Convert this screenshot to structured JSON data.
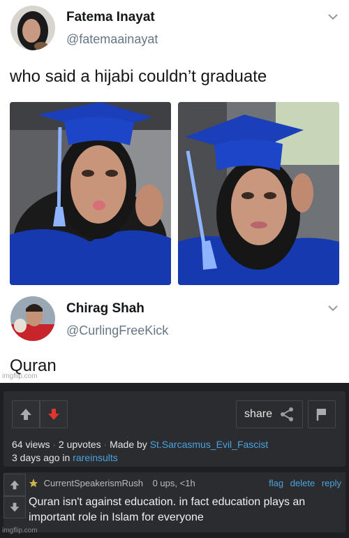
{
  "tweet1": {
    "name": "Fatema Inayat",
    "handle": "@fatemaainayat",
    "text": "who said a hijabi couldn’t graduate"
  },
  "tweet2": {
    "name": "Chirag Shah",
    "handle": "@CurlingFreeKick",
    "text": "Quran"
  },
  "watermark": "imgflip.com",
  "post": {
    "share_label": "share",
    "views": "64 views",
    "upvotes": "2 upvotes",
    "made_by_label": "Made by",
    "author": "St.Sarcasmus_Evil_Fascist",
    "time": "3 days ago in",
    "community": "rareinsults"
  },
  "comment": {
    "user": "CurrentSpeakerismRush",
    "stats": "0 ups, <1h",
    "actions": [
      "flag",
      "delete",
      "reply"
    ],
    "text": "Quran isn't against education. in fact education plays an important role in Islam for everyone"
  },
  "colors": {
    "dark_bg": "#1e1f22",
    "panel_bg": "#2b2c30",
    "link": "#4aa3df",
    "downvote_active": "#e0362b",
    "cap_blue": "#1b3fb8"
  }
}
